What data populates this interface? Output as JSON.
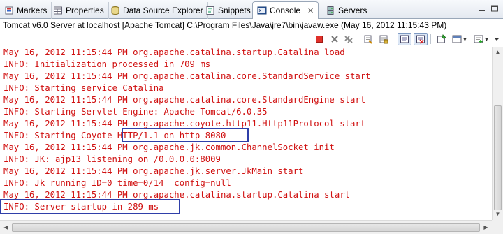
{
  "tabs": [
    {
      "label": "Markers",
      "icon": "markers-icon"
    },
    {
      "label": "Properties",
      "icon": "properties-icon"
    },
    {
      "label": "Data Source Explorer",
      "icon": "data-source-explorer-icon"
    },
    {
      "label": "Snippets",
      "icon": "snippets-icon"
    },
    {
      "label": "Console",
      "icon": "console-icon",
      "active": true
    },
    {
      "label": "Servers",
      "icon": "servers-icon"
    }
  ],
  "close_glyph": "✕",
  "title": "Tomcat v6.0 Server at localhost [Apache Tomcat] C:\\Program Files\\Java\\jre7\\bin\\javaw.exe (May 16, 2012 11:15:43 PM)",
  "toolbar_icons": [
    "terminate-icon",
    "remove-launch-icon",
    "remove-all-terminated-icon",
    "scroll-lock-icon",
    "word-wrap-icon",
    "show-console-on-output-icon",
    "show-console-on-error-icon",
    "pin-console-icon",
    "display-selected-console-icon",
    "open-console-icon",
    "view-menu-icon",
    "minimize-icon",
    "maximize-icon"
  ],
  "console_lines": [
    "May 16, 2012 11:15:44 PM org.apache.catalina.startup.Catalina load",
    "INFO: Initialization processed in 709 ms",
    "May 16, 2012 11:15:44 PM org.apache.catalina.core.StandardService start",
    "INFO: Starting service Catalina",
    "May 16, 2012 11:15:44 PM org.apache.catalina.core.StandardEngine start",
    "INFO: Starting Servlet Engine: Apache Tomcat/6.0.35",
    "May 16, 2012 11:15:44 PM org.apache.coyote.http11.Http11Protocol start",
    "INFO: Starting Coyote HTTP/1.1 on http-8080",
    "May 16, 2012 11:15:44 PM org.apache.jk.common.ChannelSocket init",
    "INFO: JK: ajp13 listening on /0.0.0.0:8009",
    "May 16, 2012 11:15:44 PM org.apache.jk.server.JkMain start",
    "INFO: Jk running ID=0 time=0/14  config=null",
    "May 16, 2012 11:15:44 PM org.apache.catalina.startup.Catalina start",
    "INFO: Server startup in 289 ms"
  ],
  "colors": {
    "console_text": "#d01010",
    "highlight_box": "#2f3fa9"
  }
}
